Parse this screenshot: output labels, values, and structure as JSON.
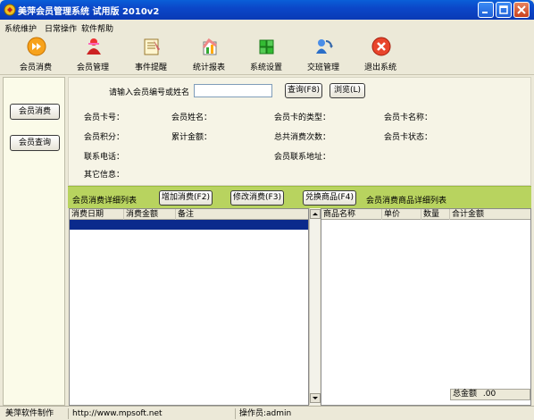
{
  "window": {
    "title": "美萍会员管理系统 试用版 2010v2"
  },
  "menu": {
    "items": [
      "系统维护",
      "日常操作",
      "软件帮助"
    ]
  },
  "toolbar": {
    "items": [
      {
        "label": "会员消费",
        "icon": "consume-icon"
      },
      {
        "label": "会员管理",
        "icon": "member-icon"
      },
      {
        "label": "事件提醒",
        "icon": "notebook-icon"
      },
      {
        "label": "统计报表",
        "icon": "report-icon"
      },
      {
        "label": "系统设置",
        "icon": "settings-icon"
      },
      {
        "label": "交班管理",
        "icon": "shift-icon"
      },
      {
        "label": "退出系统",
        "icon": "exit-icon"
      }
    ]
  },
  "sidebar": {
    "consume": "会员消费",
    "query": "会员查询"
  },
  "search": {
    "prompt": "请输入会员编号或姓名",
    "value": "",
    "query_btn": "查询(F8)",
    "browse_btn": "浏览(L)"
  },
  "info": {
    "card_no": "会员卡号：",
    "name": "会员姓名：",
    "card_type": "会员卡的类型：",
    "card_name": "会员卡名称：",
    "points": "会员积分：",
    "total_amount": "累计金额：",
    "total_count": "总共消费次数：",
    "card_status": "会员卡状态：",
    "phone": "联系电话：",
    "address": "会员联系地址：",
    "other": "其它信息："
  },
  "strip": {
    "consume_list": "会员消费详细列表",
    "add_btn": "增加消费(F2)",
    "edit_btn": "修改消费(F3)",
    "redeem_btn": "兑换商品(F4)",
    "goods_list": "会员消费商品详细列表"
  },
  "left_table": {
    "columns": [
      "消费日期",
      "消费金额",
      "备注"
    ]
  },
  "right_table": {
    "columns": [
      "商品名称",
      "单价",
      "数量",
      "合计金额"
    ]
  },
  "total": {
    "label": "总金额",
    "value": ".00"
  },
  "status": {
    "maker": "美萍软件制作",
    "url": "http://www.mpsoft.net",
    "operator": "操作员:admin"
  }
}
